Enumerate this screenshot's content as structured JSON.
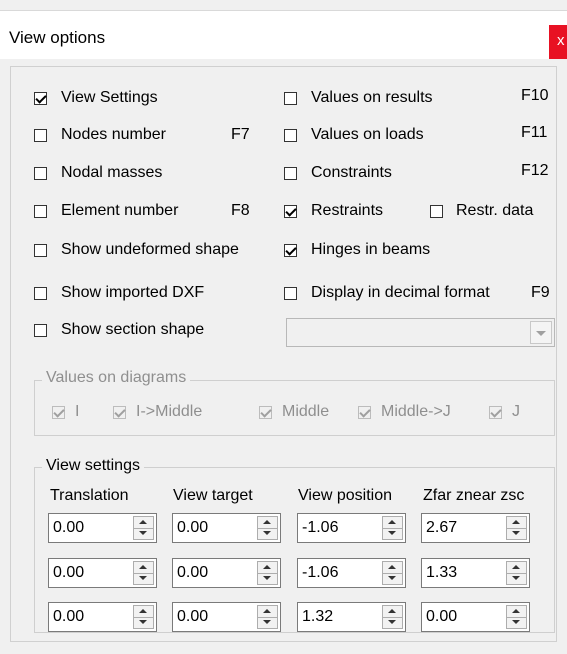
{
  "window": {
    "title": "View options",
    "close_glyph": "x"
  },
  "options": {
    "view_settings": {
      "label": "View Settings",
      "checked": true
    },
    "nodes_number": {
      "label": "Nodes number",
      "key": "F7",
      "checked": false
    },
    "nodal_masses": {
      "label": "Nodal masses",
      "checked": false
    },
    "element_number": {
      "label": "Element number",
      "key": "F8",
      "checked": false
    },
    "show_undeformed_shape": {
      "label": "Show undeformed shape",
      "checked": false
    },
    "show_imported_dxf": {
      "label": "Show imported DXF",
      "checked": false
    },
    "show_section_shape": {
      "label": "Show section shape",
      "checked": false
    },
    "values_on_results": {
      "label": "Values on results",
      "key": "F10",
      "checked": false
    },
    "values_on_loads": {
      "label": "Values on loads",
      "key": "F11",
      "checked": false
    },
    "constraints": {
      "label": "Constraints",
      "key": "F12",
      "checked": false
    },
    "restraints": {
      "label": "Restraints",
      "checked": true
    },
    "restr_data": {
      "label": "Restr. data",
      "checked": false
    },
    "hinges_in_beams": {
      "label": "Hinges in beams",
      "checked": true
    },
    "display_decimal": {
      "label": "Display in decimal format",
      "key": "F9",
      "checked": false
    }
  },
  "section_combo": {
    "value": ""
  },
  "values_on_diagrams": {
    "title": "Values on diagrams",
    "items": [
      {
        "label": "I",
        "checked": true
      },
      {
        "label": "I->Middle",
        "checked": true
      },
      {
        "label": "Middle",
        "checked": true
      },
      {
        "label": "Middle->J",
        "checked": true
      },
      {
        "label": "J",
        "checked": true
      }
    ]
  },
  "view_settings_group": {
    "title": "View settings",
    "columns": [
      "Translation",
      "View target",
      "View position",
      "Zfar znear zsc"
    ],
    "rows": [
      [
        "0.00",
        "0.00",
        "-1.06",
        "2.67"
      ],
      [
        "0.00",
        "0.00",
        "-1.06",
        "1.33"
      ],
      [
        "0.00",
        "0.00",
        "1.32",
        "0.00"
      ]
    ]
  }
}
